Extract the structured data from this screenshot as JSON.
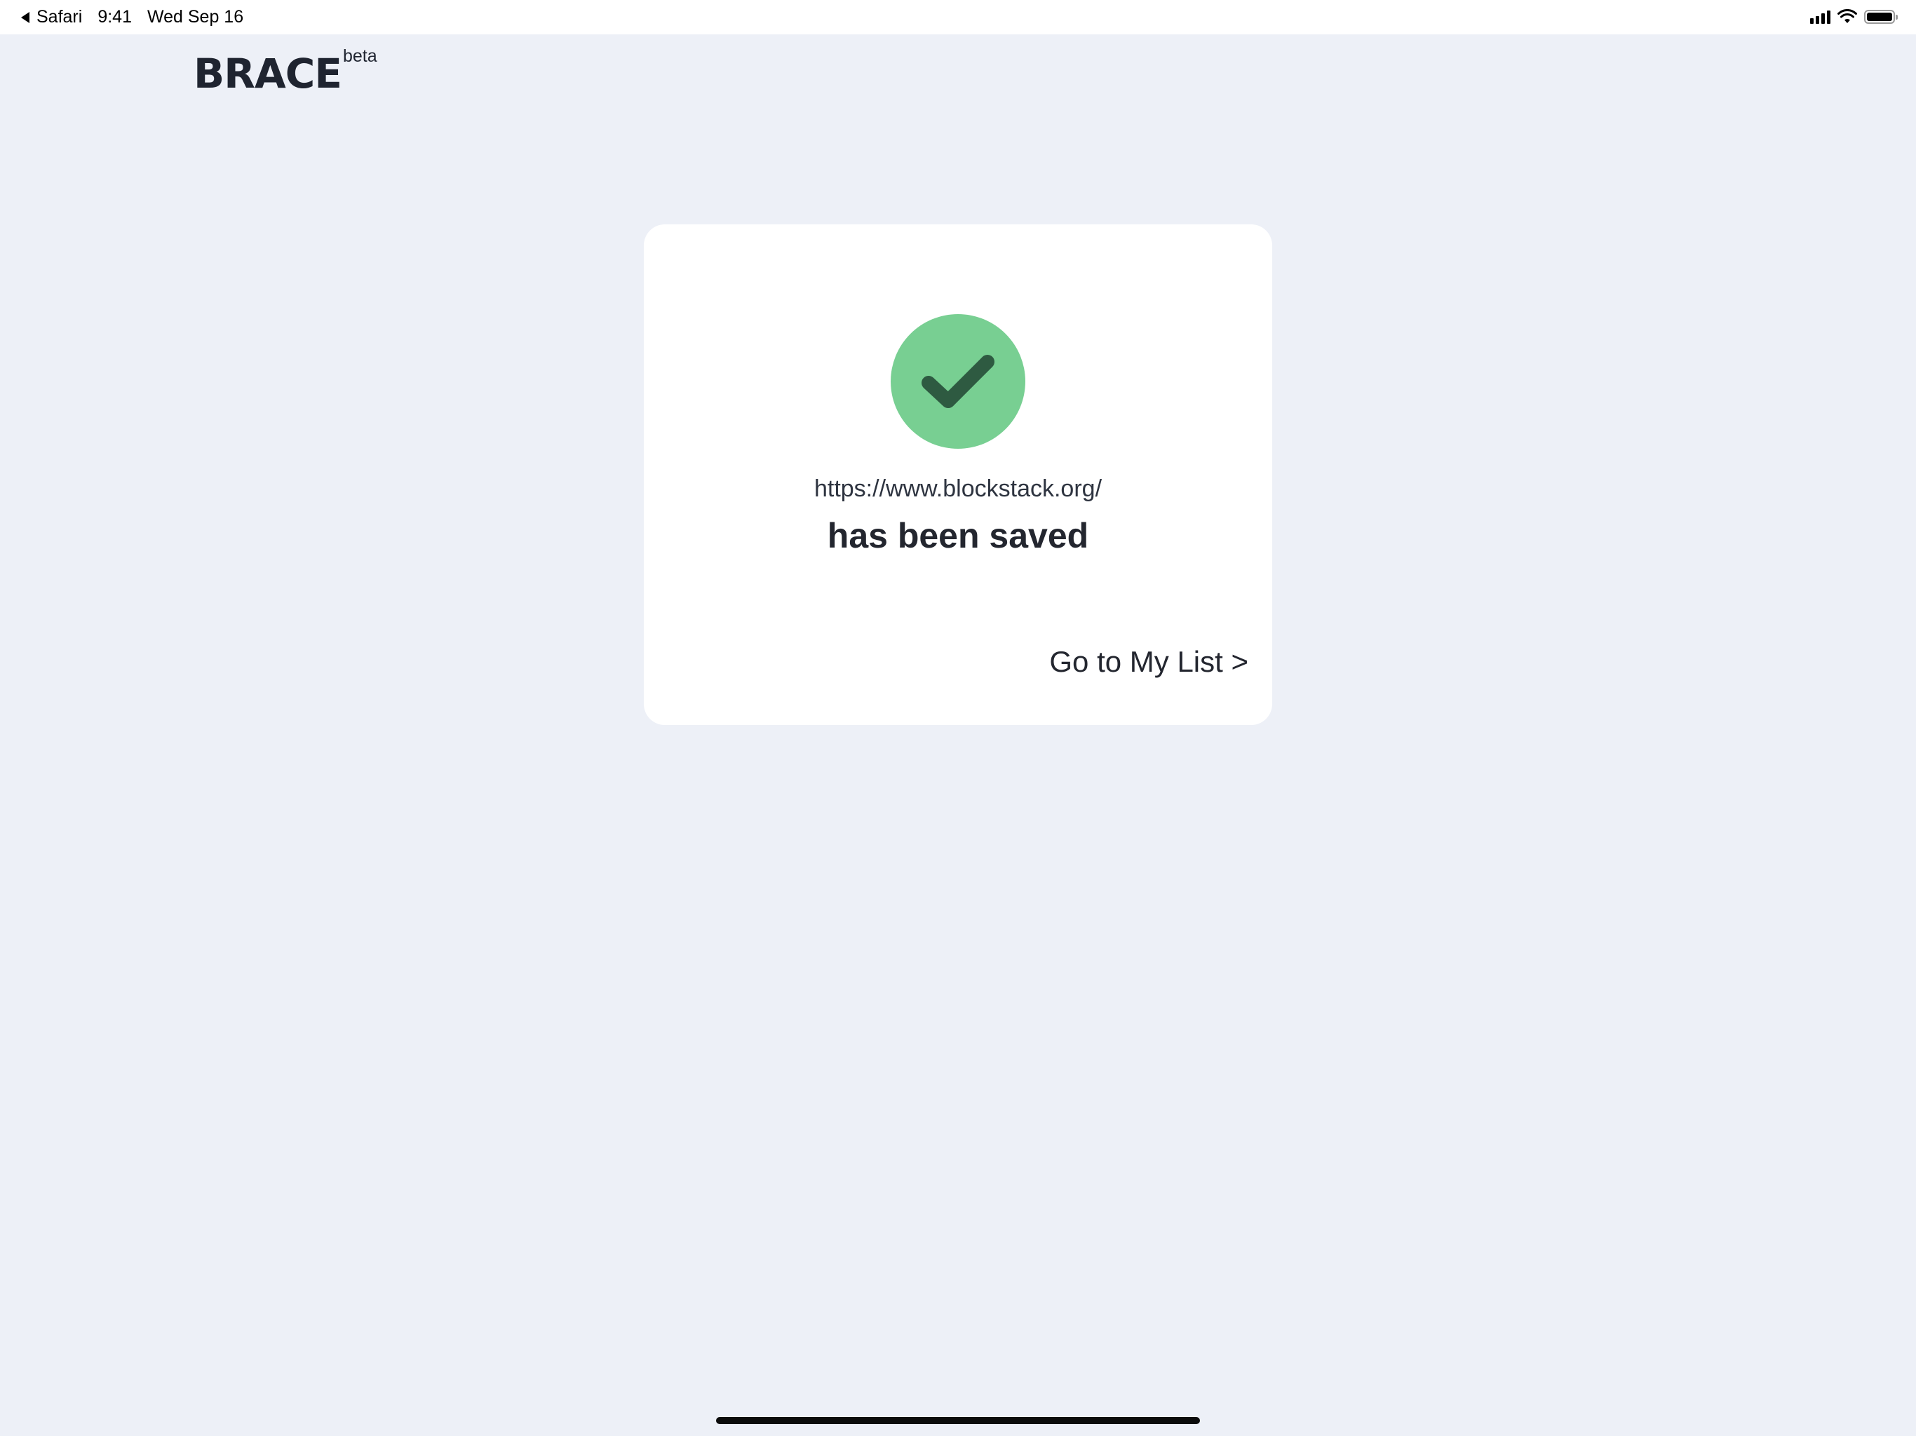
{
  "status_bar": {
    "back_app": "Safari",
    "time": "9:41",
    "date": "Wed Sep 16",
    "icons": [
      "back-arrow-icon",
      "cellular-signal-icon",
      "wifi-icon",
      "battery-icon"
    ]
  },
  "header": {
    "logo_text": "BRACE",
    "logo_badge": "beta"
  },
  "card": {
    "icon": "checkmark-icon",
    "saved_url": "https://www.blockstack.org/",
    "message": "has been saved",
    "link_label": "Go to My List >"
  },
  "colors": {
    "background": "#edf0f7",
    "card": "#ffffff",
    "success_circle": "#78cf92",
    "success_check": "#2e5a41",
    "text": "#23262f"
  }
}
